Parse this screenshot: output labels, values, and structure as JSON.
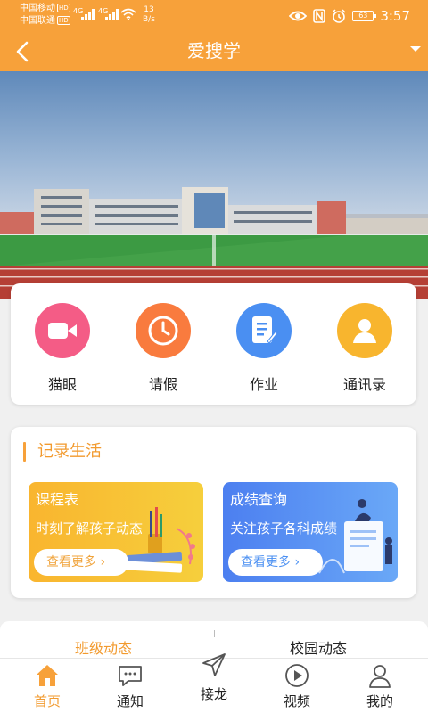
{
  "status_bar": {
    "carrier1": "中国移动",
    "carrier2": "中国联通",
    "hd_badge": "HD",
    "network1": "4G",
    "network2": "4G",
    "net_speed_value": "13",
    "net_speed_unit": "B/s",
    "battery": "63",
    "time": "3:57"
  },
  "header": {
    "title": "爱搜学",
    "back_icon": "chevron-left-icon",
    "dropdown_icon": "triangle-down-icon"
  },
  "menu": {
    "items": [
      {
        "label": "猫眼",
        "icon": "video-camera-icon",
        "color": "#f45c86"
      },
      {
        "label": "请假",
        "icon": "clock-icon",
        "color": "#f97b3e"
      },
      {
        "label": "作业",
        "icon": "document-edit-icon",
        "color": "#4a8ff2"
      },
      {
        "label": "通讯录",
        "icon": "contact-person-icon",
        "color": "#f8b52e"
      }
    ]
  },
  "life": {
    "title": "记录生活",
    "cards": [
      {
        "title": "课程表",
        "desc": "时刻了解孩子动态",
        "more": "查看更多",
        "more_color": "#f0a33a",
        "colors": [
          "#f9b52f",
          "#f6cf3c"
        ]
      },
      {
        "title": "成绩查询",
        "desc": "关注孩子各科成绩",
        "more": "查看更多",
        "more_color": "#4a8ff2",
        "colors": [
          "#4c7ff0",
          "#6aa8f7"
        ]
      }
    ]
  },
  "tabs": [
    {
      "label": "班级动态",
      "active": true
    },
    {
      "label": "校园动态",
      "active": false
    }
  ],
  "nav": [
    {
      "label": "首页",
      "icon": "home-icon",
      "active": true
    },
    {
      "label": "通知",
      "icon": "message-icon",
      "active": false
    },
    {
      "label": "接龙",
      "icon": "paper-plane-icon",
      "active": false
    },
    {
      "label": "视频",
      "icon": "play-circle-icon",
      "active": false
    },
    {
      "label": "我的",
      "icon": "person-icon",
      "active": false
    }
  ],
  "colors": {
    "brand": "#f7a13a",
    "accent_text": "#f29a2e",
    "blue": "#4a8ff2"
  }
}
